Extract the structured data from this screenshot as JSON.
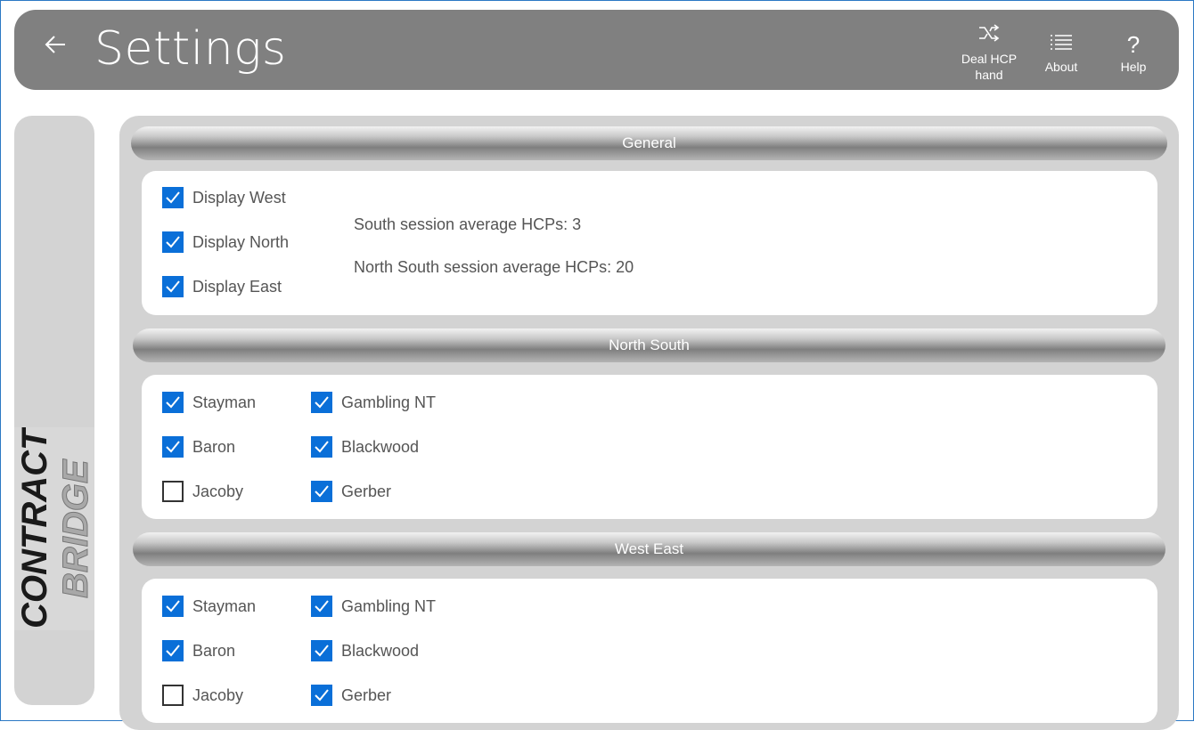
{
  "header": {
    "back_icon": "back-arrow-icon",
    "title": "Settings",
    "buttons": {
      "deal": {
        "label_line1": "Deal HCP",
        "label_line2": "hand",
        "icon": "shuffle-icon"
      },
      "about": {
        "label": "About",
        "icon": "list-icon"
      },
      "help": {
        "label": "Help",
        "icon": "question-icon"
      }
    }
  },
  "logo": {
    "line1": "CONTRACT",
    "line2": "BRIDGE"
  },
  "general": {
    "header": "General",
    "checkboxes": [
      {
        "label": "Display West",
        "checked": true
      },
      {
        "label": "Display North",
        "checked": true
      },
      {
        "label": "Display East",
        "checked": true
      }
    ],
    "south_avg": "South session average HCPs: 3",
    "ns_avg": "North South session average HCPs: 20"
  },
  "north_south": {
    "header": "North South",
    "col1": [
      {
        "label": "Stayman",
        "checked": true
      },
      {
        "label": "Baron",
        "checked": true
      },
      {
        "label": "Jacoby",
        "checked": false
      }
    ],
    "col2": [
      {
        "label": "Gambling NT",
        "checked": true
      },
      {
        "label": "Blackwood",
        "checked": true
      },
      {
        "label": "Gerber",
        "checked": true
      }
    ]
  },
  "west_east": {
    "header": "West East",
    "col1": [
      {
        "label": "Stayman",
        "checked": true
      },
      {
        "label": "Baron",
        "checked": true
      },
      {
        "label": "Jacoby",
        "checked": false
      }
    ],
    "col2": [
      {
        "label": "Gambling NT",
        "checked": true
      },
      {
        "label": "Blackwood",
        "checked": true
      },
      {
        "label": "Gerber",
        "checked": true
      }
    ]
  },
  "colors": {
    "accent": "#0a6fd8",
    "bar": "#808080",
    "panel": "#d3d3d3"
  }
}
